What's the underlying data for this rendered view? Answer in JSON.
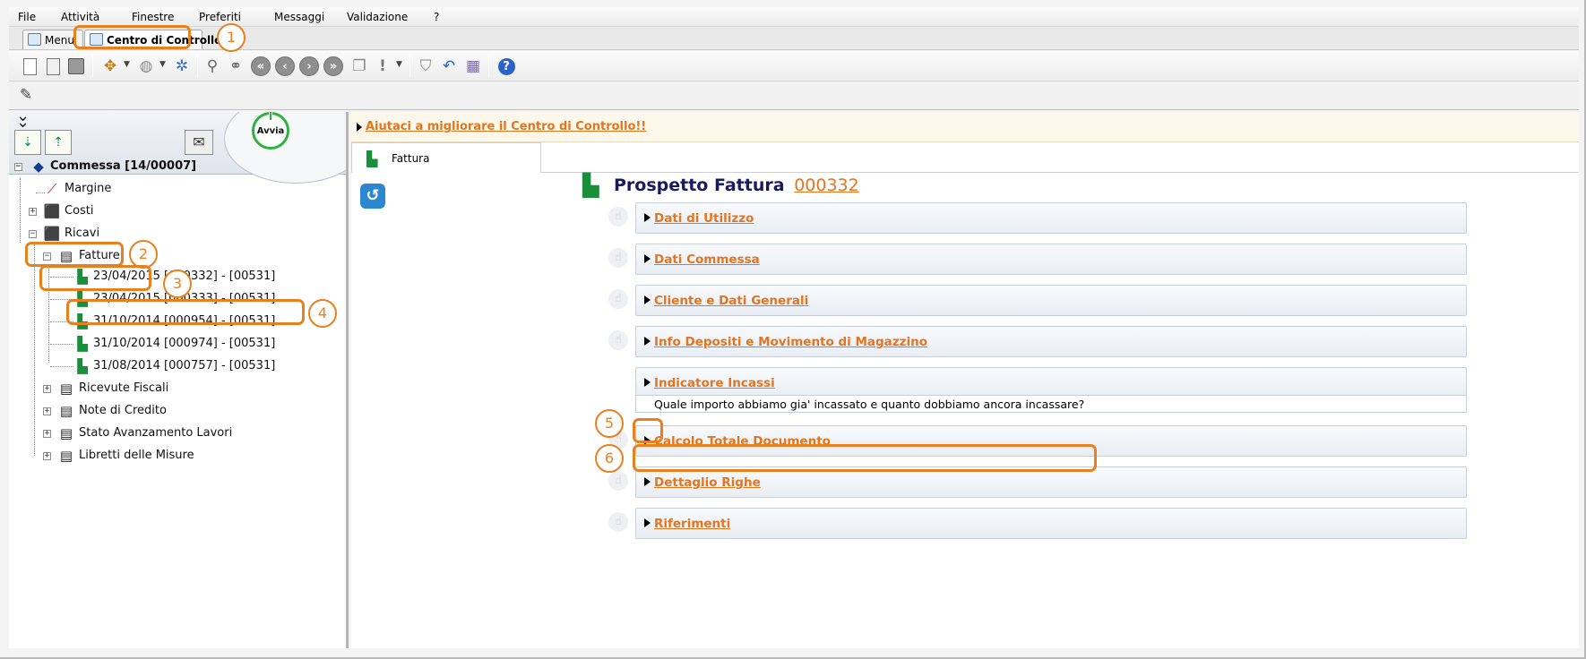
{
  "menu": {
    "items": [
      "File",
      "Attività",
      "Finestre",
      "Preferiti",
      "Messaggi",
      "Validazione",
      "?"
    ]
  },
  "tabs": [
    {
      "label": "Menu",
      "active": false
    },
    {
      "label": "Centro di Controllo",
      "active": true
    }
  ],
  "sidebar": {
    "avvia_label": "Avvia",
    "root": "Commessa [14/00007]",
    "margine": "Margine",
    "costi": "Costi",
    "ricavi": "Ricavi",
    "fatture": "Fatture",
    "invoices": [
      "23/04/2015 [000332] - [00531]",
      "23/04/2015 [000333] - [00531]",
      "31/10/2014 [000954] - [00531]",
      "31/10/2014 [000974] - [00531]",
      "31/08/2014 [000757] - [00531]"
    ],
    "ricevute": "Ricevute Fiscali",
    "note": "Note di Credito",
    "stato": "Stato Avanzamento Lavori",
    "libretti": "Libretti delle Misure"
  },
  "main": {
    "banner_link": "Aiutaci a migliorare il Centro di Controllo!!",
    "doc_tab": "Fattura",
    "title": "Prospetto Fattura",
    "invoice_number": "000332",
    "sections": [
      "Dati di Utilizzo",
      "Dati Commessa",
      "Cliente e Dati Generali",
      "Info Depositi e Movimento di Magazzino",
      "Indicatore Incassi",
      "Calcolo Totale Documento",
      "Dettaglio Righe",
      "Riferimenti"
    ],
    "question": "Quale importo abbiamo gia' incassato e quanto dobbiamo ancora incassare?"
  },
  "callouts": [
    "1",
    "2",
    "3",
    "4",
    "5",
    "6"
  ],
  "colors": {
    "accent": "#e8801e",
    "link": "#e5741e",
    "title": "#1a1a5e"
  }
}
